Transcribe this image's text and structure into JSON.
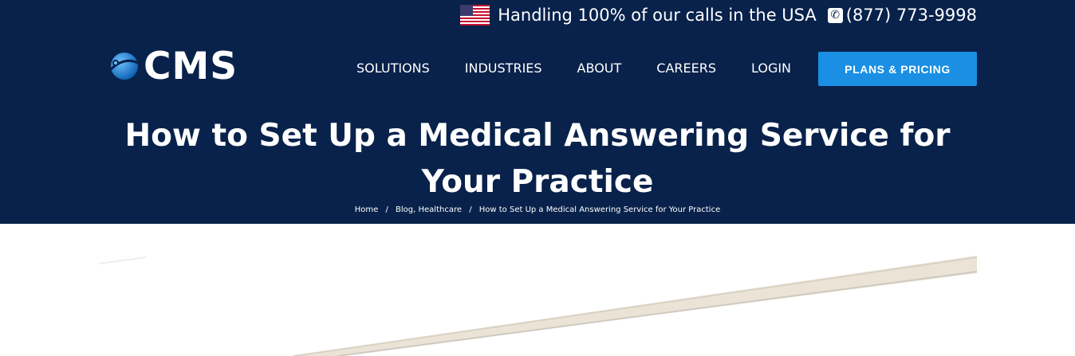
{
  "topbar": {
    "message": "Handling 100% of our calls in the USA",
    "phone": "(877) 773-9998",
    "flag_icon": "us-flag-icon",
    "phone_icon": "phone-icon"
  },
  "logo": {
    "text": "CMS",
    "icon": "globe-icon"
  },
  "nav": {
    "items": [
      "SOLUTIONS",
      "INDUSTRIES",
      "ABOUT",
      "CAREERS",
      "LOGIN"
    ],
    "cta_label": "PLANS & PRICING"
  },
  "page": {
    "title": "How to Set Up a Medical Answering Service for Your Practice"
  },
  "breadcrumb": {
    "home": "Home",
    "separator": "/",
    "categories": "Blog, Healthcare",
    "current": "How to Set Up a Medical Answering Service for Your Practice"
  },
  "colors": {
    "header_bg": "#08224b",
    "cta_bg": "#1a8fe3",
    "text": "#ffffff"
  }
}
